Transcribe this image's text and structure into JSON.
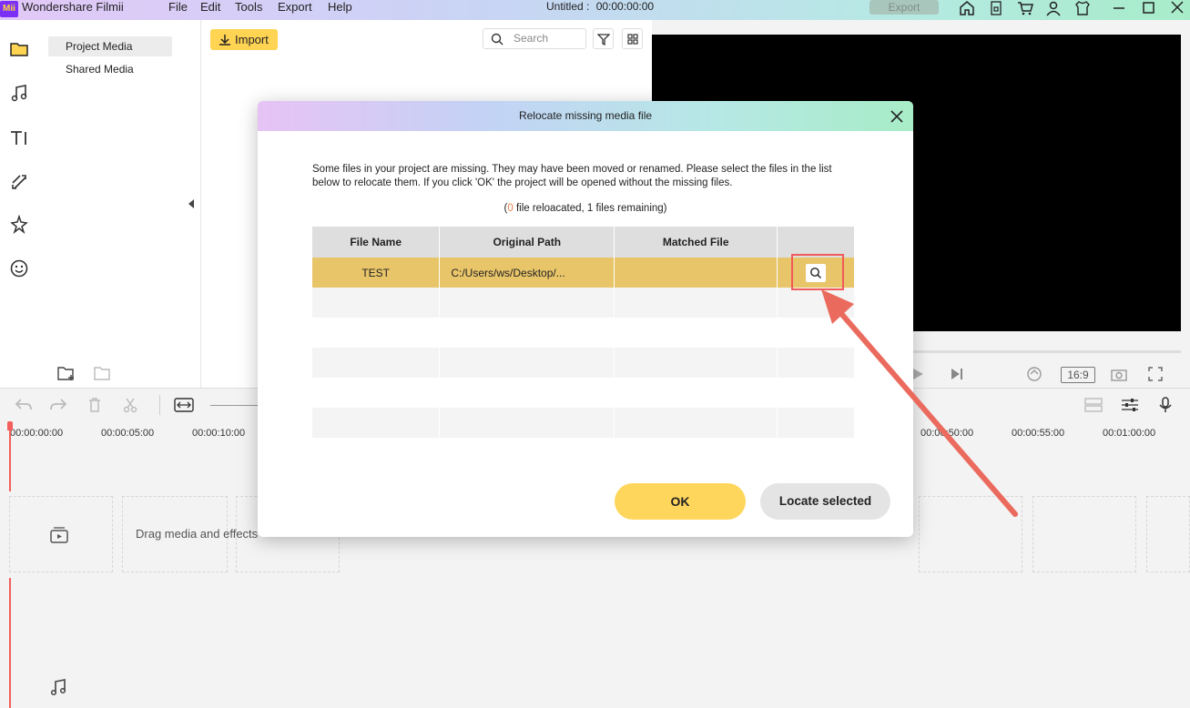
{
  "app": {
    "name": "Wondershare Filmii",
    "logo_text": "Mii",
    "project_title": "Untitled :",
    "project_time": "00:00:00:00",
    "export_label": "Export"
  },
  "menu": [
    "File",
    "Edit",
    "Tools",
    "Export",
    "Help"
  ],
  "media_panel": {
    "project_media": "Project Media",
    "shared_media": "Shared Media",
    "import_label": "Import",
    "search_placeholder": "Search"
  },
  "preview": {
    "aspect_ratio": "16:9"
  },
  "timeline": {
    "ticks": [
      "00:00:00:00",
      "00:00:05:00",
      "00:00:10:00",
      "00:00:50:00",
      "00:00:55:00",
      "00:01:00:00"
    ],
    "track_hint": "Drag media and effects"
  },
  "dialog": {
    "title": "Relocate missing media file",
    "message": "Some files in your project are missing. They may have been moved or renamed. Please select the files in the list below to relocate them. If you click 'OK' the project will be opened without the missing files.",
    "status_open": "(",
    "status_count": "0",
    "status_rest": " file reloacated, 1 files remaining)",
    "columns": [
      "File Name",
      "Original Path",
      "Matched File"
    ],
    "rows": [
      {
        "file_name": "TEST",
        "original_path": "C:/Users/ws/Desktop/...",
        "matched_file": ""
      }
    ],
    "ok_label": "OK",
    "locate_label": "Locate selected"
  },
  "colors": {
    "accent_yellow": "#ffd453",
    "selected_row": "#e9c56a",
    "annotation_red": "#f05a5a",
    "playhead": "#f25f5c"
  }
}
